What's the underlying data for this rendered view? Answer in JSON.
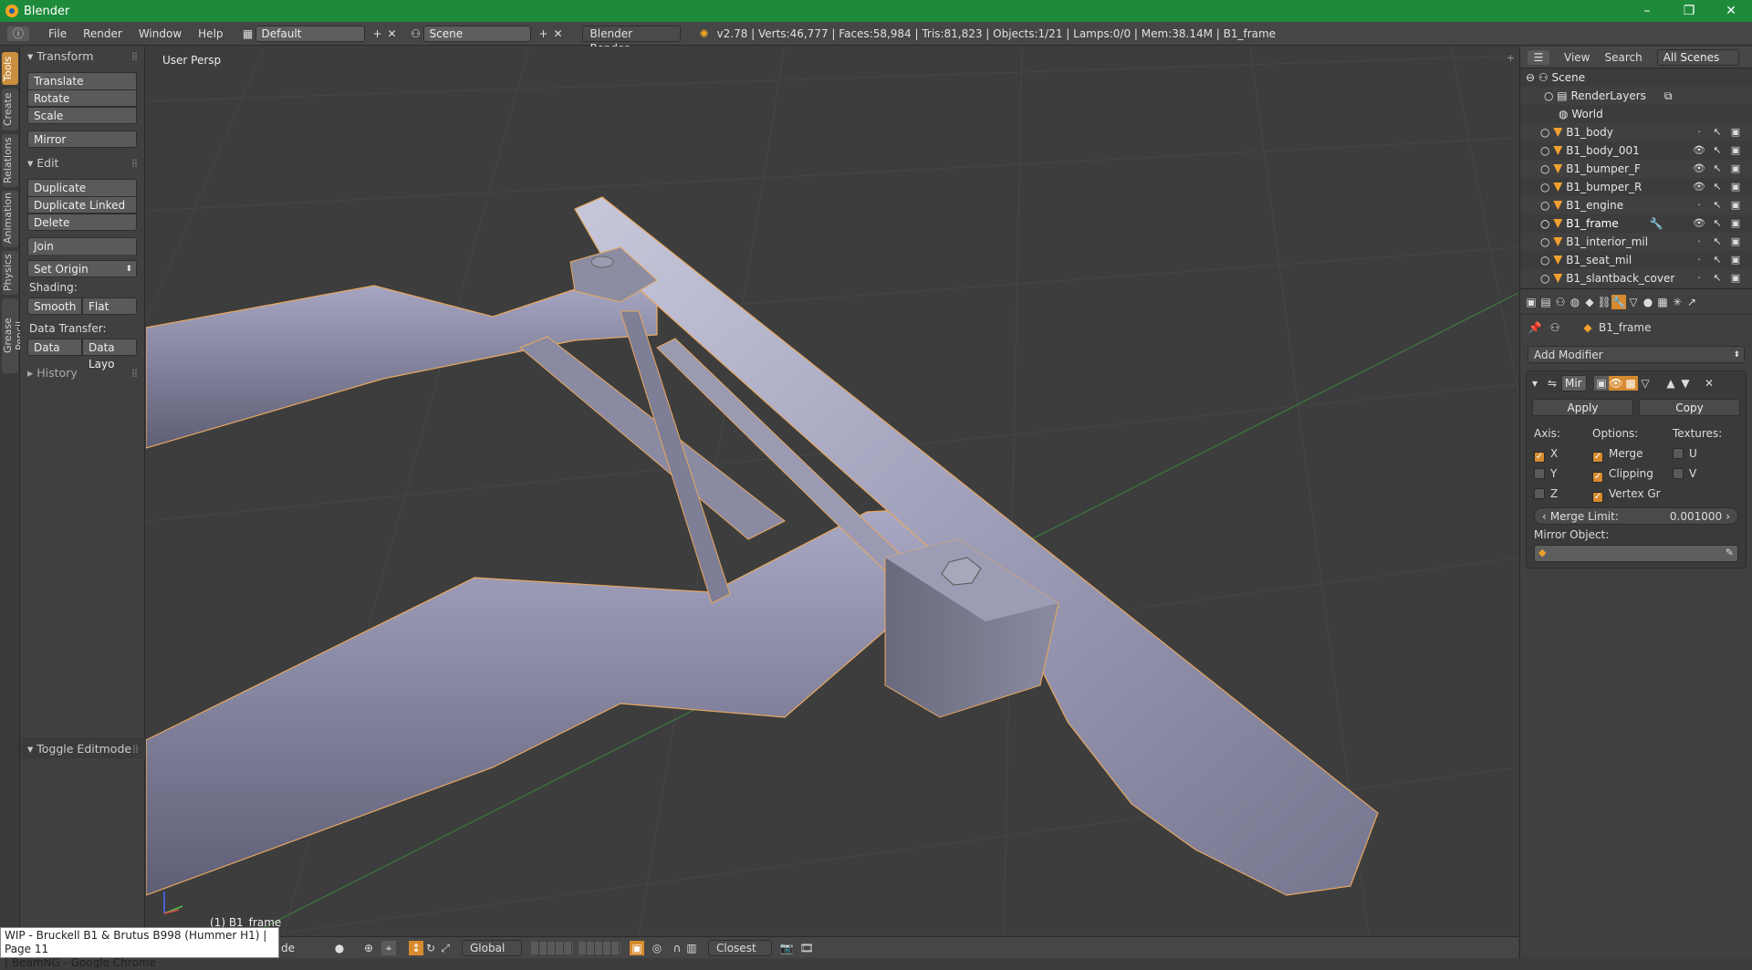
{
  "window": {
    "title": "Blender",
    "minimize": "–",
    "maximize": "❐",
    "close": "✕"
  },
  "infobar": {
    "menus": [
      "File",
      "Render",
      "Window",
      "Help"
    ],
    "layout": "Default",
    "scene": "Scene",
    "engine": "Blender Render",
    "stats": "v2.78 | Verts:46,777 | Faces:58,984 | Tris:81,823 | Objects:1/21 | Lamps:0/0 | Mem:38.14M | B1_frame"
  },
  "vtabs": [
    "Tools",
    "Create",
    "Relations",
    "Animation",
    "Physics",
    "Grease Pencil"
  ],
  "toolshelf": {
    "transform": {
      "title": "Transform",
      "translate": "Translate",
      "rotate": "Rotate",
      "scale": "Scale",
      "mirror": "Mirror"
    },
    "edit": {
      "title": "Edit",
      "duplicate": "Duplicate",
      "duplicate_linked": "Duplicate Linked",
      "delete": "Delete",
      "join": "Join",
      "set_origin": "Set Origin",
      "shading_label": "Shading:",
      "smooth": "Smooth",
      "flat": "Flat",
      "data_transfer_label": "Data Transfer:",
      "data": "Data",
      "data_layo": "Data Layo"
    },
    "history": "History",
    "toggle_editmode": "Toggle Editmode"
  },
  "viewport": {
    "label": "User Persp",
    "object": "(1) B1_frame"
  },
  "header": {
    "mode": "de",
    "orientation": "Global",
    "snap": "Closest"
  },
  "taskbar_popup": {
    "line1": "WIP - Bruckell B1 & Brutus B998 (Hummer H1) | Page 11",
    "line2": "| BeamNG - Google Chrome"
  },
  "outliner": {
    "view": "View",
    "search": "Search",
    "filter": "All Scenes",
    "scene": "Scene",
    "render_layers": "RenderLayers",
    "world": "World",
    "objects": [
      "B1_body",
      "B1_body_001",
      "B1_bumper_F",
      "B1_bumper_R",
      "B1_engine",
      "B1_frame",
      "B1_interior_mil",
      "B1_seat_mil",
      "B1_slantback_cover"
    ]
  },
  "properties": {
    "object": "B1_frame",
    "add_modifier": "Add Modifier",
    "mod_name": "Mir",
    "apply": "Apply",
    "copy": "Copy",
    "axis_label": "Axis:",
    "options_label": "Options:",
    "textures_label": "Textures:",
    "x": "X",
    "y": "Y",
    "z": "Z",
    "merge": "Merge",
    "clipping": "Clipping",
    "vertex_gr": "Vertex Gr",
    "u": "U",
    "v": "V",
    "merge_limit_label": "Merge Limit:",
    "merge_limit_value": "0.001000",
    "mirror_object_label": "Mirror Object:"
  },
  "colors": {
    "titlebar": "#1e8b3a",
    "accent": "#d78a2e",
    "bg": "#3d3d3d"
  }
}
